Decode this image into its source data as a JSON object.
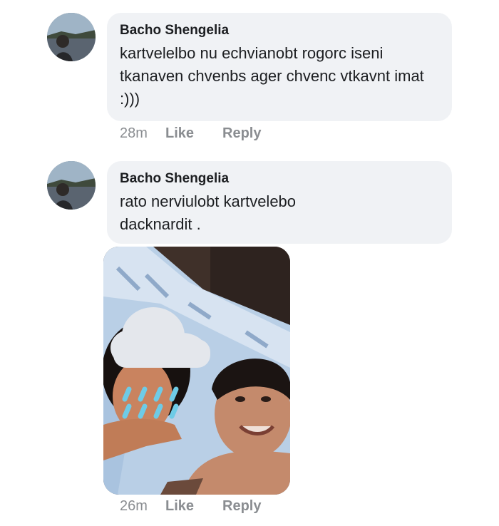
{
  "comments": [
    {
      "author": "Bacho Shengelia",
      "text": "kartvelelbo nu echvianobt rogorc iseni tkanaven chvenbs ager chvenc vtkavnt imat :)))",
      "time": "28m",
      "like": "Like",
      "reply": "Reply"
    },
    {
      "author": "Bacho Shengelia",
      "text": "rato nerviulobt kartvelebo dacknardit .",
      "time": "26m",
      "like": "Like",
      "reply": "Reply"
    }
  ]
}
